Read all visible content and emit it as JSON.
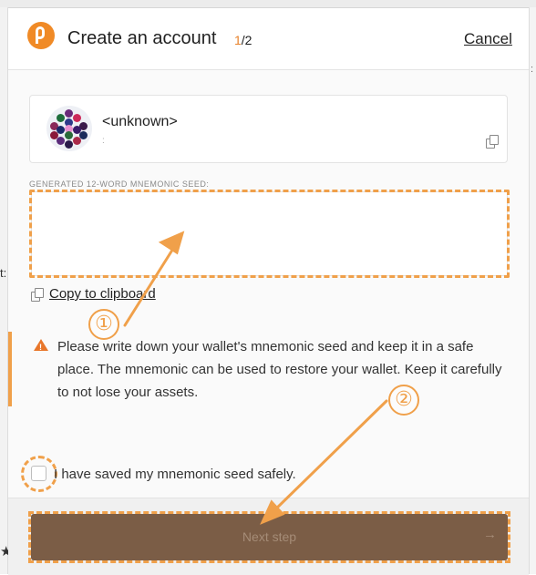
{
  "header": {
    "title": "Create an account",
    "step_current": "1",
    "step_total": "/2",
    "cancel_label": "Cancel"
  },
  "account": {
    "name": "<unknown>",
    "address": ":"
  },
  "seed": {
    "label": "GENERATED 12-WORD MNEMONIC SEED:",
    "value": "",
    "copy_label": "Copy to clipboard"
  },
  "warning": {
    "text": "Please write down your wallet's mnemonic seed and keep it in a safe place. The mnemonic can be used to restore your wallet. Keep it carefully to not lose your assets."
  },
  "confirm": {
    "label": "I have saved my mnemonic seed safely.",
    "checked": false
  },
  "footer": {
    "next_label": "Next step",
    "next_arrow": "→"
  },
  "annotations": {
    "badge1": "①",
    "badge2": "②"
  },
  "colors": {
    "accent": "#f08a26",
    "highlight": "#f0a04a",
    "button": "#7b5d46"
  },
  "icons": {
    "logo": "polkadot-logo",
    "copy": "copy-icon",
    "warning": "warning-triangle-icon",
    "next": "arrow-right-icon"
  }
}
